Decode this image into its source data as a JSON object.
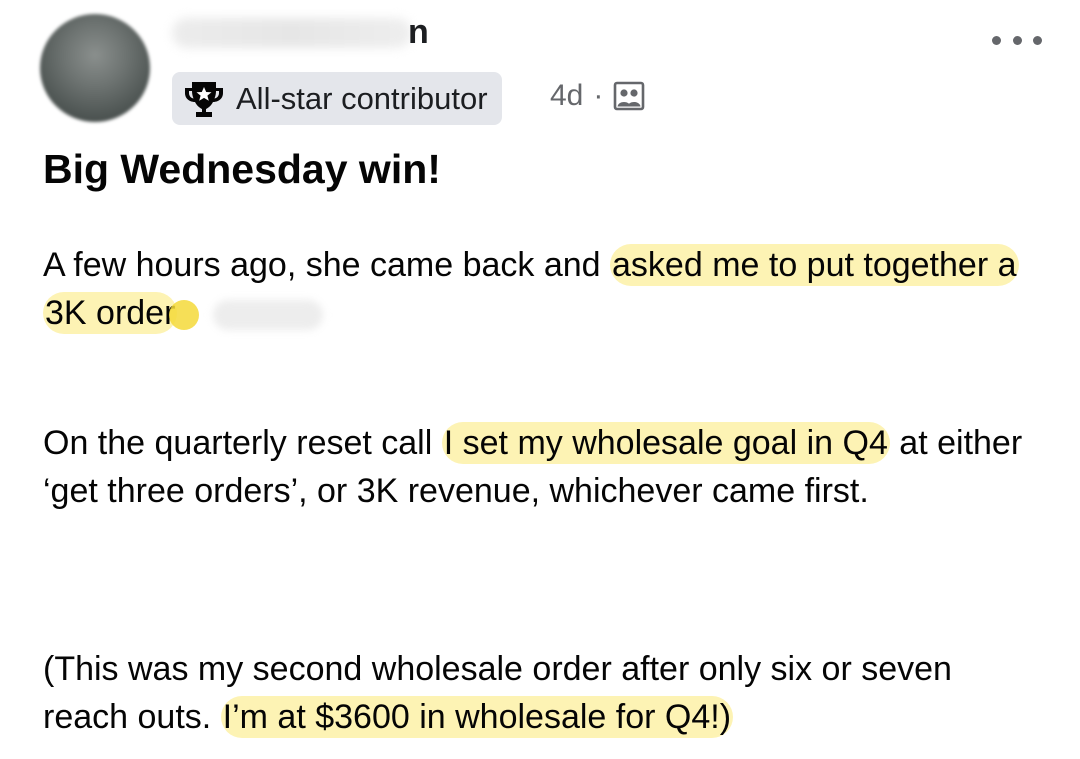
{
  "post": {
    "author_name_visible_tail": "n",
    "badge_label": "All-star contributor",
    "age": "4d",
    "separator": "·",
    "audience_icon": "group-icon",
    "more_icon": "more-dots-icon",
    "title": "Big Wednesday win!"
  },
  "paragraphs": [
    {
      "before": "A few hours ago, she came back and ",
      "highlight": "asked me to put together a 3K order",
      "after": ""
    },
    {
      "before": "On the quarterly reset call ",
      "highlight": "I set my wholesale goal in Q4",
      "after": " at either ‘get three orders’, or 3K revenue, whichever came first."
    },
    {
      "before": "(This was my second wholesale order after only six or seven reach outs. ",
      "highlight": "I’m at $3600 in wholesale for Q4!)",
      "after": ""
    }
  ],
  "colors": {
    "highlight": "#fdf3b4",
    "badge_bg": "#e4e6eb",
    "meta_text": "#65676b"
  }
}
